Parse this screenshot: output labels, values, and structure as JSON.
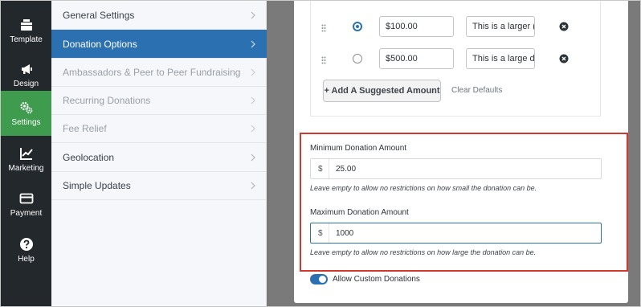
{
  "rail": {
    "items": [
      {
        "label": "Template",
        "icon": "template-icon"
      },
      {
        "label": "Design",
        "icon": "megaphone-icon"
      },
      {
        "label": "Settings",
        "icon": "gears-icon"
      },
      {
        "label": "Marketing",
        "icon": "chart-icon"
      },
      {
        "label": "Payment",
        "icon": "credit-card-icon"
      },
      {
        "label": "Help",
        "icon": "question-icon"
      }
    ],
    "active": "Settings",
    "accent": "#3f9c4f"
  },
  "submenu": {
    "items": [
      {
        "label": "General Settings"
      },
      {
        "label": "Donation Options"
      },
      {
        "label": "Ambassadors & Peer to Peer Fundraising"
      },
      {
        "label": "Recurring Donations"
      },
      {
        "label": "Fee Relief"
      },
      {
        "label": "Geolocation"
      },
      {
        "label": "Simple Updates"
      }
    ],
    "active": "Donation Options",
    "accent": "#2b71b1"
  },
  "suggested_amounts": {
    "rows": [
      {
        "amount": "$100.00",
        "label": "This is a larger (",
        "selected": true
      },
      {
        "amount": "$500.00",
        "label": "This is a large do",
        "selected": false
      }
    ],
    "add_button": "+ Add A Suggested Amount",
    "clear_link": "Clear Defaults"
  },
  "limits": {
    "minimum": {
      "label": "Minimum Donation Amount",
      "currency": "$",
      "value": "25.00",
      "help": "Leave empty to allow no restrictions on how small the donation can be."
    },
    "maximum": {
      "label": "Maximum Donation Amount",
      "currency": "$",
      "value": "1000",
      "help": "Leave empty to allow no restrictions on how large the donation can be."
    },
    "highlight_color": "#d0392b"
  },
  "custom_donations": {
    "label": "Allow Custom Donations",
    "enabled": true
  }
}
